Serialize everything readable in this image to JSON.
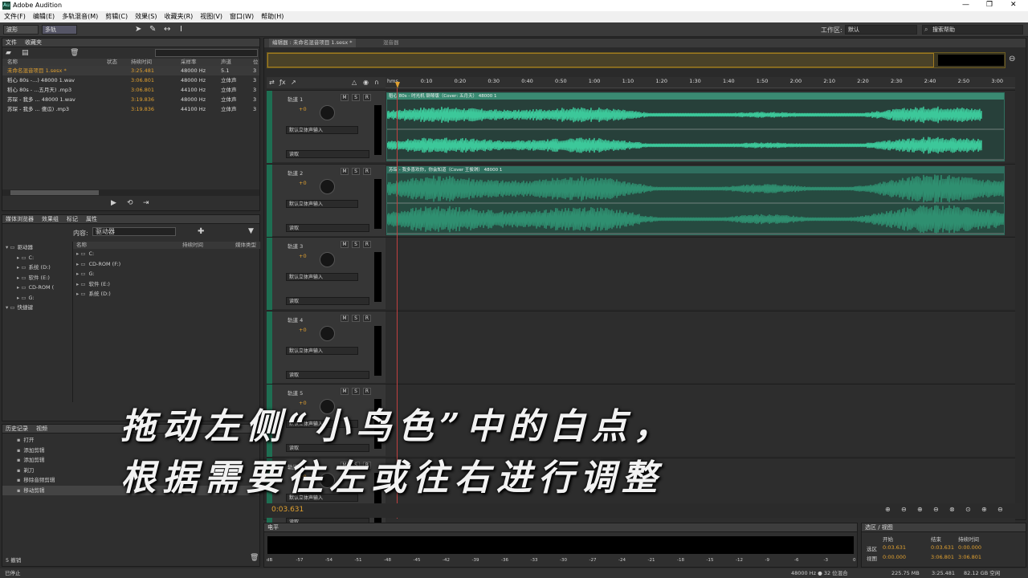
{
  "app": {
    "title": "Adobe Audition",
    "logo_text": "Au",
    "window_controls": [
      "—",
      "❐",
      "✕"
    ]
  },
  "menu": [
    "文件(F)",
    "编辑(E)",
    "多轨混音(M)",
    "剪辑(C)",
    "效果(S)",
    "收藏夹(R)",
    "视图(V)",
    "窗口(W)",
    "帮助(H)"
  ],
  "toolbar": {
    "waveform": "波形",
    "multitrack": "多轨",
    "workspace_label": "工作区:",
    "workspace_value": "默认",
    "search_placeholder": "搜索帮助"
  },
  "files_panel": {
    "tabs": [
      "文件",
      "收藏夹"
    ],
    "columns": [
      "名称",
      "状态",
      "持续时间",
      "采样率",
      "声道",
      "位"
    ],
    "search_placeholder": "",
    "rows": [
      {
        "name": "未命名混音项目 1.sesx *",
        "duration": "3:25.481",
        "rate": "48000 Hz",
        "channels": "5.1",
        "bits": "3"
      },
      {
        "name": "稻心 80s -...)   48000 1.wav",
        "duration": "3:06.801",
        "rate": "48000 Hz",
        "channels": "立体声",
        "bits": "3"
      },
      {
        "name": "稻心 80s - ...五月天) .mp3",
        "duration": "3:06.801",
        "rate": "44100 Hz",
        "channels": "立体声",
        "bits": "3"
      },
      {
        "name": "苏琛 - 我多 ... 48000 1.wav",
        "duration": "3:19.836",
        "rate": "48000 Hz",
        "channels": "立体声",
        "bits": "3"
      },
      {
        "name": "苏琛 - 我多 ... 傻瓜) .mp3",
        "duration": "3:19.836",
        "rate": "44100 Hz",
        "channels": "立体声",
        "bits": "3"
      }
    ]
  },
  "media_panel": {
    "tabs": [
      "媒体浏览器",
      "效果组",
      "标记",
      "属性"
    ],
    "content_label": "内容:",
    "content_value": "驱动器",
    "tree": [
      "驱动器",
      "C:",
      "系统 (D:)",
      "软件 (E:)",
      "CD-ROM (",
      "G:",
      "快捷键"
    ],
    "columns": [
      "名称",
      "持续时间",
      "媒体类型"
    ],
    "items": [
      "C:",
      "CD-ROM (F:)",
      "G:",
      "软件 (E:)",
      "系统 (D:)"
    ]
  },
  "history_panel": {
    "tabs": [
      "历史记录",
      "视频"
    ],
    "items": [
      "打开",
      "添加剪辑",
      "添加剪辑",
      "剃刀",
      "移除音频剪辑",
      "移动剪辑"
    ],
    "undo_count": "5 撤销"
  },
  "editor": {
    "tabs": [
      "编辑器 : 未命名混音项目 1.sesx *",
      "混音器"
    ],
    "ruler": [
      "hms",
      "0:10",
      "0:20",
      "0:30",
      "0:40",
      "0:50",
      "1:00",
      "1:10",
      "1:20",
      "1:30",
      "1:40",
      "1:50",
      "2:00",
      "2:10",
      "2:20",
      "2:30",
      "2:40",
      "2:50",
      "3:00"
    ],
    "tracks": [
      {
        "name": "轨道 1",
        "vol": "+0",
        "input": "默认立体声输入",
        "mode": "读取",
        "clip": "稻心 80s - 时光机 钢琴版（Cover: 五月天） 48000 1"
      },
      {
        "name": "轨道 2",
        "vol": "+0",
        "input": "默认立体声输入",
        "mode": "读取",
        "clip": "苏琛 - 我多喜欢你，你会知道（Cover 王俊琪） 48000 1"
      },
      {
        "name": "轨道 3",
        "vol": "+0",
        "input": "默认立体声输入",
        "mode": "读取",
        "clip": ""
      },
      {
        "name": "轨道 4",
        "vol": "+0",
        "input": "默认立体声输入",
        "mode": "读取",
        "clip": ""
      },
      {
        "name": "轨道 5",
        "vol": "+0",
        "input": "默认立体声输入",
        "mode": "读取",
        "clip": ""
      },
      {
        "name": "轨道 6",
        "vol": "+0",
        "input": "默认立体声输入",
        "mode": "读取",
        "clip": ""
      }
    ],
    "time": "0:03.631"
  },
  "levels": {
    "title": "电平",
    "ticks": [
      "dB",
      "-57",
      "-54",
      "-51",
      "-48",
      "-45",
      "-42",
      "-39",
      "-36",
      "-33",
      "-30",
      "-27",
      "-24",
      "-21",
      "-18",
      "-15",
      "-12",
      "-9",
      "-6",
      "-3",
      "0"
    ]
  },
  "selection": {
    "title": "选区 / 视图",
    "cols": [
      "开始",
      "结束",
      "持续时间"
    ],
    "sel": {
      "label": "选区",
      "start": "0:03.631",
      "end": "0:03.631",
      "dur": "0:00.000"
    },
    "view": {
      "label": "视图",
      "start": "0:00.000",
      "end": "3:06.801",
      "dur": "3:06.801"
    }
  },
  "status": {
    "left": "已停止",
    "rate": "48000 Hz ● 32 位混合",
    "size": "225.75 MB",
    "dur": "3:25.481",
    "free": "82.12 GB 空闲"
  },
  "caption": {
    "line1": "拖动左侧“小鸟色”中的白点，",
    "line2": "根据需要往左或往右进行调整"
  },
  "colors": {
    "accent": "#e0a030",
    "clip": "#3cc89a",
    "clip2": "#2f8f70",
    "caption": "#f2f2f2"
  }
}
